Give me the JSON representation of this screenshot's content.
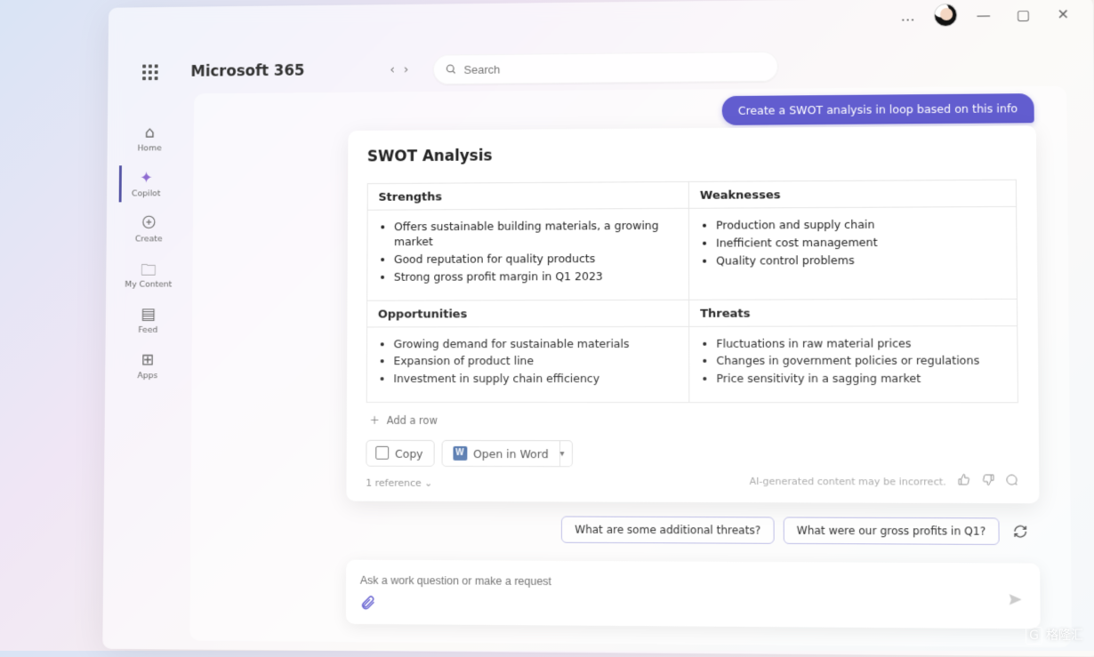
{
  "window": {
    "more_label": "…",
    "minimize": "—",
    "maximize": "▢",
    "close": "✕"
  },
  "header": {
    "app_title": "Microsoft 365",
    "search_placeholder": "Search"
  },
  "sidebar": {
    "items": [
      {
        "label": "Home",
        "icon": "⌂"
      },
      {
        "label": "Copilot",
        "icon": "✦"
      },
      {
        "label": "Create",
        "icon": "＋"
      },
      {
        "label": "My Content",
        "icon": "🗀"
      },
      {
        "label": "Feed",
        "icon": "▤"
      },
      {
        "label": "Apps",
        "icon": "⊞"
      }
    ]
  },
  "chat": {
    "user_prompt": "Create a SWOT analysis in loop based on this info",
    "card": {
      "title": "SWOT Analysis",
      "cells": {
        "strengths": {
          "heading": "Strengths",
          "items": [
            "Offers sustainable building materials, a growing market",
            "Good reputation for quality products",
            "Strong gross profit margin in Q1 2023"
          ]
        },
        "weaknesses": {
          "heading": "Weaknesses",
          "items": [
            "Production and supply chain",
            "Inefficient cost management",
            "Quality control problems"
          ]
        },
        "opportunities": {
          "heading": "Opportunities",
          "items": [
            "Growing demand for sustainable materials",
            "Expansion of product line",
            "Investment in supply chain efficiency"
          ]
        },
        "threats": {
          "heading": "Threats",
          "items": [
            "Fluctuations in raw material prices",
            "Changes in government policies or regulations",
            "Price sensitivity in a sagging market"
          ]
        }
      },
      "add_row": "Add a row",
      "copy_label": "Copy",
      "open_word_label": "Open in Word",
      "disclaimer": "AI-generated content may be incorrect.",
      "references": "1 reference"
    },
    "suggestions": [
      "What are some additional threats?",
      "What were our gross profits in Q1?"
    ],
    "composer_placeholder": "Ask a work question or make a request"
  },
  "watermark": "格隆汇"
}
